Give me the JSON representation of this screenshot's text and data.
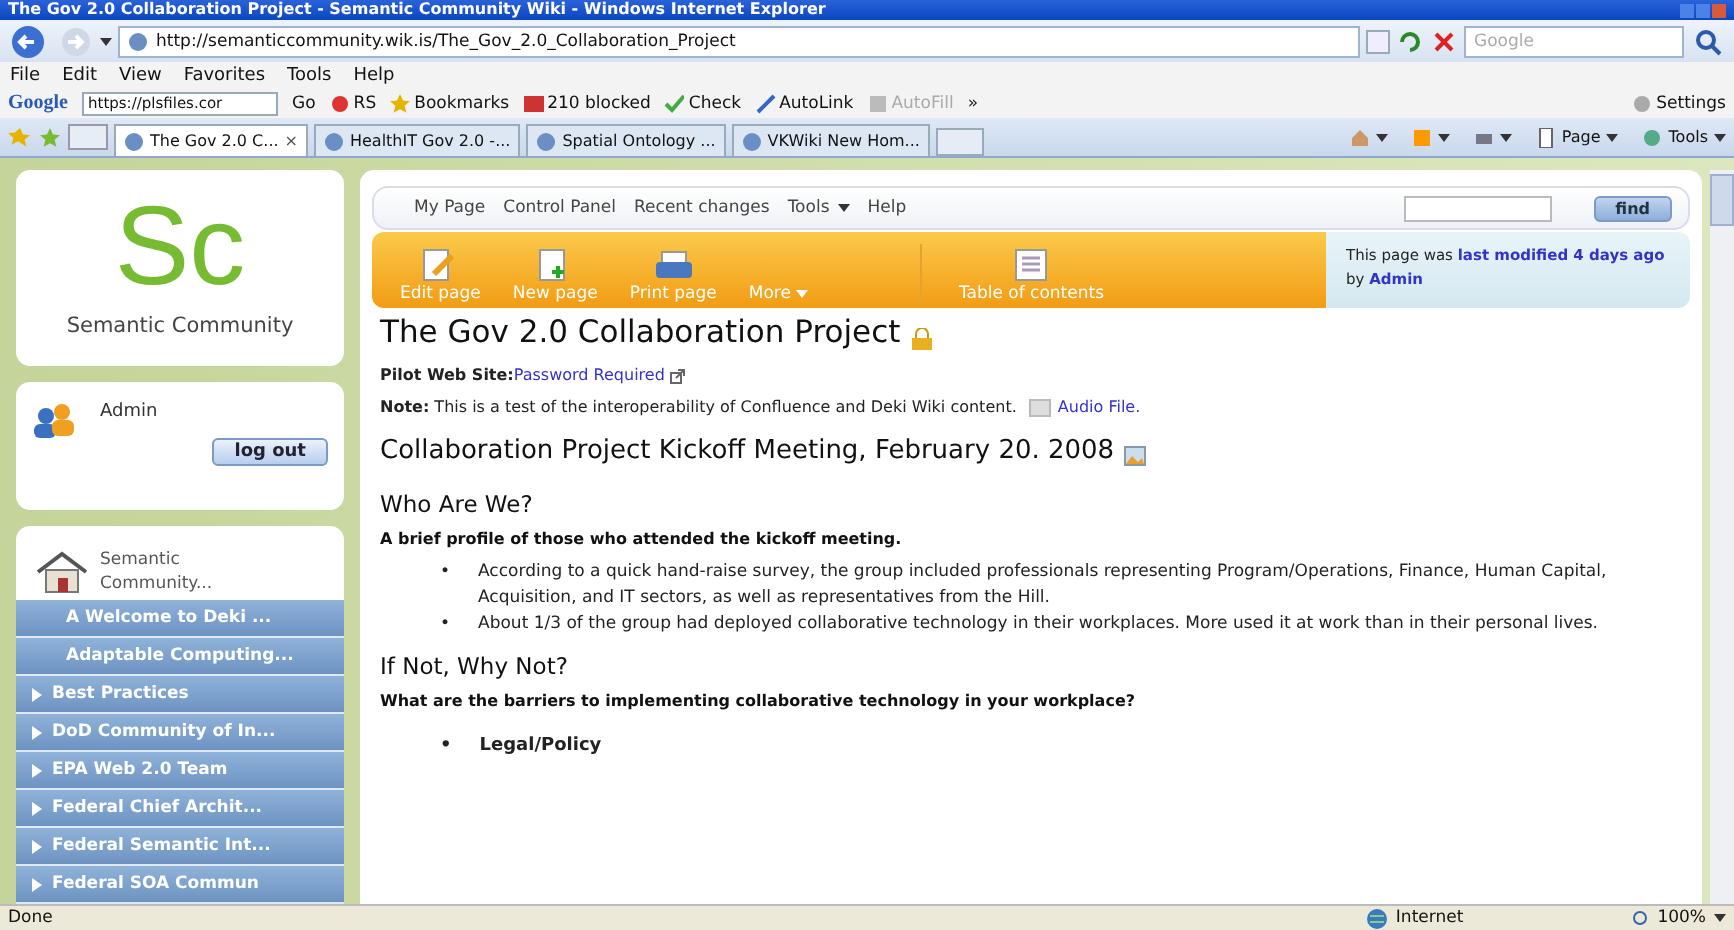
{
  "window": {
    "title": "The Gov 2.0 Collaboration Project - Semantic Community Wiki - Windows Internet Explorer"
  },
  "address_bar": {
    "url": "http://semanticcommunity.wik.is/The_Gov_2.0_Collaboration_Project",
    "search_placeholder": "Google"
  },
  "menu": [
    "File",
    "Edit",
    "View",
    "Favorites",
    "Tools",
    "Help"
  ],
  "google_toolbar": {
    "logo": "Google",
    "field": "https://plsfiles.cor",
    "go": "Go",
    "items": [
      {
        "kind": "rs",
        "label": "RS"
      },
      {
        "kind": "star",
        "label": "Bookmarks"
      },
      {
        "kind": "block",
        "label": "210 blocked"
      },
      {
        "kind": "check",
        "label": "Check"
      },
      {
        "kind": "link",
        "label": "AutoLink"
      },
      {
        "kind": "fill",
        "label": "AutoFill",
        "disabled": true
      },
      {
        "kind": "more",
        "label": "»"
      }
    ],
    "settings": "Settings"
  },
  "tabs": [
    {
      "label": "The Gov 2.0 C...",
      "selected": true,
      "close": "×"
    },
    {
      "label": "HealthIT Gov 2.0 -...",
      "selected": false
    },
    {
      "label": "Spatial Ontology ...",
      "selected": false
    },
    {
      "label": "VKWiki New Hom...",
      "selected": false
    }
  ],
  "command_bar": [
    {
      "kind": "home"
    },
    {
      "kind": "feed"
    },
    {
      "kind": "print"
    },
    {
      "kind": "page",
      "label": "Page"
    },
    {
      "kind": "tools",
      "label": "Tools"
    }
  ],
  "sidebar": {
    "logo_mark": "Sc",
    "logo_text": "Semantic Community",
    "user": "Admin",
    "logout": "log out",
    "home": "Semantic Community...",
    "items": [
      {
        "label": "A Welcome to Deki ...",
        "kind": "page",
        "selected": false
      },
      {
        "label": "Adaptable Computing...",
        "kind": "page",
        "selected": false
      },
      {
        "label": "Best Practices",
        "kind": "folder",
        "selected": false
      },
      {
        "label": "DoD Community of In...",
        "kind": "folder",
        "selected": false
      },
      {
        "label": "EPA Web 2.0 Team",
        "kind": "folder",
        "selected": false
      },
      {
        "label": "Federal Chief Archit...",
        "kind": "folder",
        "selected": false
      },
      {
        "label": "Federal Semantic Int...",
        "kind": "folder",
        "selected": false
      },
      {
        "label": "Federal SOA Commun",
        "kind": "folder",
        "selected": false
      }
    ]
  },
  "top_nav": [
    {
      "label": "My Page",
      "dropdown": false
    },
    {
      "label": "Control Panel",
      "dropdown": false
    },
    {
      "label": "Recent changes",
      "dropdown": false
    },
    {
      "label": "Tools",
      "dropdown": true
    },
    {
      "label": "Help",
      "dropdown": false
    }
  ],
  "find_button": "find",
  "page_toolbar": [
    {
      "kind": "edit",
      "label": "Edit page"
    },
    {
      "kind": "new",
      "label": "New page"
    },
    {
      "kind": "print",
      "label": "Print page"
    },
    {
      "kind": "more",
      "label": "More"
    },
    {
      "kind": "toc",
      "label": "Table of contents"
    }
  ],
  "modified": {
    "prefix": "This page was",
    "link": "last modified 4 days ago",
    "middle": "by",
    "author": "Admin"
  },
  "article": {
    "title": "The Gov 2.0 Collaboration Project",
    "blocks": [
      {
        "kind": "line",
        "label": "Pilot Web Site:",
        "link": "Password Required"
      },
      {
        "kind": "line",
        "label": "Note:",
        "text": "This is a test of the interoperability of Confluence and Deki Wiki content.",
        "link": "Audio File."
      },
      {
        "kind": "h2",
        "text": "Collaboration Project Kickoff Meeting, February 20. 2008"
      },
      {
        "kind": "h3",
        "text": "Who Are We?"
      },
      {
        "kind": "lead",
        "text": "A brief profile of those who attended the kickoff meeting."
      },
      {
        "kind": "list",
        "bold": false,
        "bullet": "•",
        "items": [
          "According to a quick hand-raise survey, the group included professionals representing Program/Operations, Finance, Human Capital, Acquisition, and IT sectors, as well as representatives from the Hill.",
          "About 1/3 of the group had deployed collaborative technology in their workplaces. More used it at work than in their personal lives."
        ]
      },
      {
        "kind": "h3",
        "text": "If Not, Why Not?"
      },
      {
        "kind": "lead",
        "text": "What are the barriers to implementing collaborative technology in your workplace?"
      },
      {
        "kind": "list",
        "bold": true,
        "bullet": "•",
        "items": [
          "Legal/Policy"
        ]
      }
    ]
  },
  "status_bar": {
    "text": "Done",
    "zone": "Internet",
    "zoom": "100%"
  }
}
